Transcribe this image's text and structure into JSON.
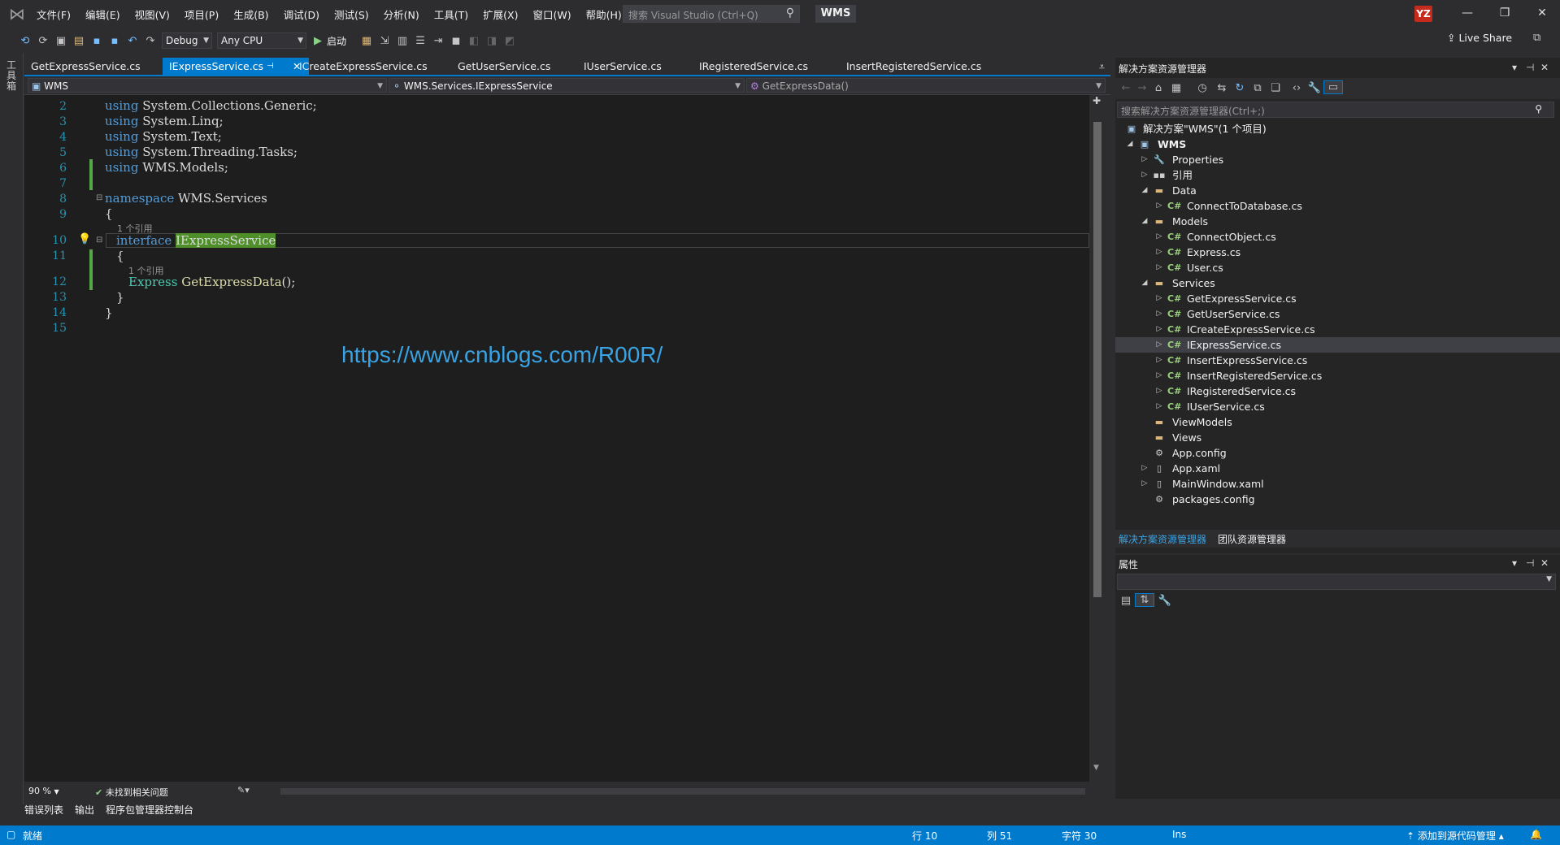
{
  "menu": {
    "items": [
      "文件(F)",
      "编辑(E)",
      "视图(V)",
      "项目(P)",
      "生成(B)",
      "调试(D)",
      "测试(S)",
      "分析(N)",
      "工具(T)",
      "扩展(X)",
      "窗口(W)",
      "帮助(H)"
    ],
    "search_placeholder": "搜索 Visual Studio (Ctrl+Q)",
    "solution_name": "WMS",
    "avatar_initials": "YZ"
  },
  "toolbar": {
    "config": "Debug",
    "platform": "Any CPU",
    "start_label": "启动",
    "live_share": "Live Share"
  },
  "left_strip": {
    "label": "工具箱"
  },
  "tabs": [
    {
      "label": "GetExpressService.cs"
    },
    {
      "label": "IExpressService.cs"
    },
    {
      "label": "ICreateExpressService.cs"
    },
    {
      "label": "GetUserService.cs"
    },
    {
      "label": "IUserService.cs"
    },
    {
      "label": "IRegisteredService.cs"
    },
    {
      "label": "InsertRegisteredService.cs"
    }
  ],
  "navbar": {
    "project": "WMS",
    "type": "WMS.Services.IExpressService",
    "member": "GetExpressData()"
  },
  "code": {
    "line_numbers": [
      "2",
      "3",
      "4",
      "5",
      "6",
      "7",
      "8",
      "9",
      "10",
      "11",
      "12",
      "13",
      "14",
      "15"
    ],
    "using_kw": "using",
    "ns_collections": "System.Collections.Generic;",
    "ns_linq": "System.Linq;",
    "ns_text": "System.Text;",
    "ns_threading": "System.Threading.Tasks;",
    "ns_models": "WMS.Models;",
    "namespace_kw": "namespace",
    "namespace_name": "WMS.Services",
    "open_brace": "{",
    "close_brace": "}",
    "codelens_1": "1 个引用",
    "interface_kw": "interface",
    "interface_name": "IExpressService",
    "codelens_2": "1 个引用",
    "return_type": "Express",
    "method_name": "GetExpressData",
    "method_tail": "();"
  },
  "watermark": "https://www.cnblogs.com/R00R/",
  "editor_status": {
    "zoom": "90 %",
    "issues": "未找到相关问题"
  },
  "bottom_tabs": [
    "错误列表",
    "输出",
    "程序包管理器控制台"
  ],
  "statusbar": {
    "ready": "就绪",
    "line": "行 10",
    "col": "列 51",
    "char": "字符 30",
    "ins": "Ins",
    "source_control": "添加到源代码管理"
  },
  "solution_explorer": {
    "title": "解决方案资源管理器",
    "search_placeholder": "搜索解决方案资源管理器(Ctrl+;)",
    "tree": [
      {
        "label": "解决方案\"WMS\"(1 个项目)",
        "icon": "solution-icon"
      },
      {
        "label": "WMS",
        "icon": "project-icon"
      },
      {
        "label": "Properties",
        "icon": "wrench-icon"
      },
      {
        "label": "引用",
        "icon": "references-icon"
      },
      {
        "label": "Data",
        "icon": "folder-icon"
      },
      {
        "label": "ConnectToDatabase.cs",
        "icon": "csharp-file-icon"
      },
      {
        "label": "Models",
        "icon": "folder-icon"
      },
      {
        "label": "ConnectObject.cs",
        "icon": "csharp-file-icon"
      },
      {
        "label": "Express.cs",
        "icon": "csharp-file-icon"
      },
      {
        "label": "User.cs",
        "icon": "csharp-file-icon"
      },
      {
        "label": "Services",
        "icon": "folder-icon"
      },
      {
        "label": "GetExpressService.cs",
        "icon": "csharp-file-icon"
      },
      {
        "label": "GetUserService.cs",
        "icon": "csharp-file-icon"
      },
      {
        "label": "ICreateExpressService.cs",
        "icon": "csharp-file-icon"
      },
      {
        "label": "IExpressService.cs",
        "icon": "csharp-file-icon"
      },
      {
        "label": "InsertExpressService.cs",
        "icon": "csharp-file-icon"
      },
      {
        "label": "InsertRegisteredService.cs",
        "icon": "csharp-file-icon"
      },
      {
        "label": "IRegisteredService.cs",
        "icon": "csharp-file-icon"
      },
      {
        "label": "IUserService.cs",
        "icon": "csharp-file-icon"
      },
      {
        "label": "ViewModels",
        "icon": "folder-icon"
      },
      {
        "label": "Views",
        "icon": "folder-icon"
      },
      {
        "label": "App.config",
        "icon": "config-file-icon"
      },
      {
        "label": "App.xaml",
        "icon": "xaml-file-icon"
      },
      {
        "label": "MainWindow.xaml",
        "icon": "xaml-file-icon"
      },
      {
        "label": "packages.config",
        "icon": "config-file-icon"
      }
    ],
    "bottom_tabs": [
      "解决方案资源管理器",
      "团队资源管理器"
    ]
  },
  "properties": {
    "title": "属性"
  },
  "colors": {
    "accent": "#007acc",
    "keyword": "#569cd6",
    "type": "#4ec9b0",
    "highlight": "#4e8f2a",
    "watermark": "#3aa3e3"
  }
}
